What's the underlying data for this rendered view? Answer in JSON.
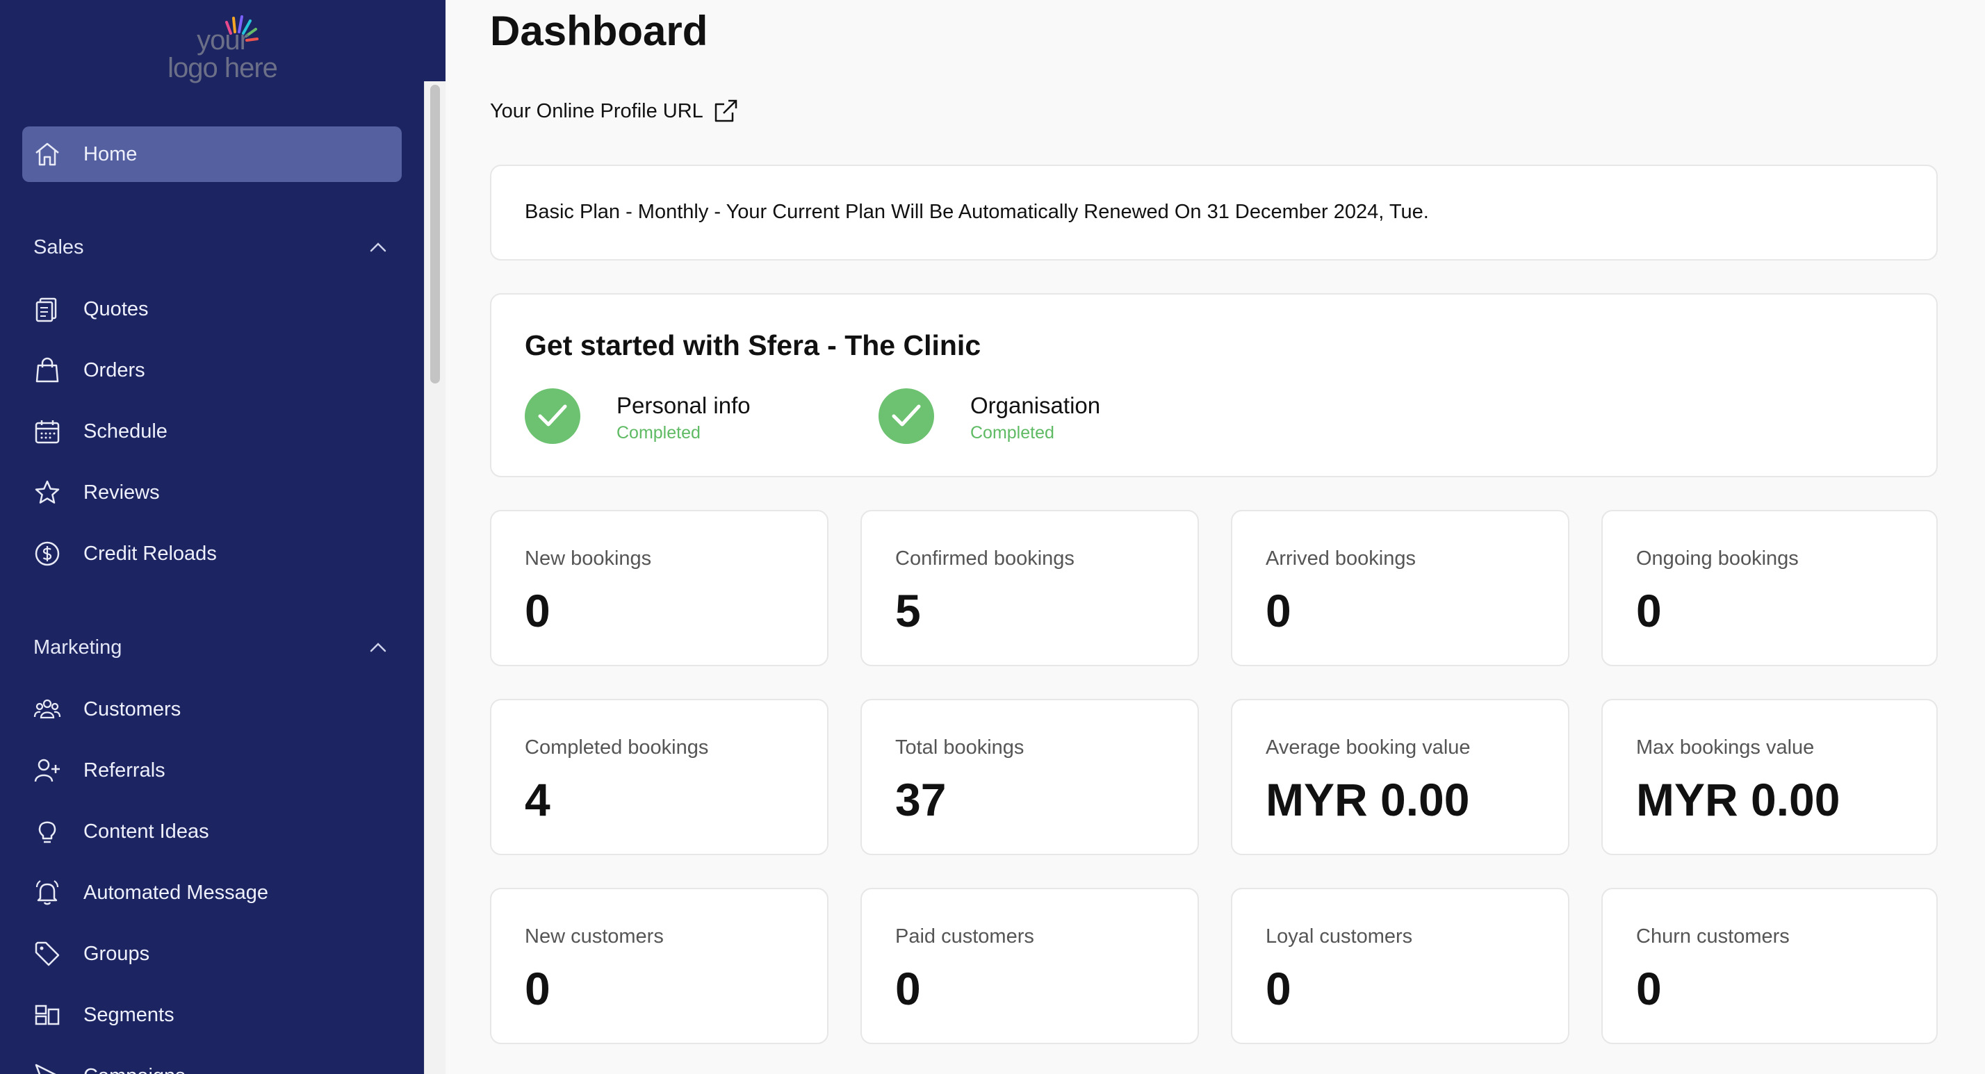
{
  "logo": {
    "line1": "your",
    "line2": "logo here"
  },
  "sidebar": {
    "home": {
      "label": "Home"
    },
    "sections": [
      {
        "title": "Sales",
        "items": [
          "Quotes",
          "Orders",
          "Schedule",
          "Reviews",
          "Credit Reloads"
        ]
      },
      {
        "title": "Marketing",
        "items": [
          "Customers",
          "Referrals",
          "Content Ideas",
          "Automated Message",
          "Groups",
          "Segments",
          "Campaigns"
        ]
      }
    ]
  },
  "main": {
    "title": "Dashboard",
    "profile_link": "Your Online Profile URL",
    "plan_notice": "Basic Plan - Monthly - Your Current Plan Will Be Automatically Renewed On 31 December 2024, Tue.",
    "get_started": {
      "title": "Get started with Sfera - The Clinic",
      "steps": [
        {
          "title": "Personal info",
          "status": "Completed"
        },
        {
          "title": "Organisation",
          "status": "Completed"
        }
      ]
    },
    "stats": [
      {
        "label": "New bookings",
        "value": "0"
      },
      {
        "label": "Confirmed bookings",
        "value": "5"
      },
      {
        "label": "Arrived bookings",
        "value": "0"
      },
      {
        "label": "Ongoing bookings",
        "value": "0"
      },
      {
        "label": "Completed bookings",
        "value": "4"
      },
      {
        "label": "Total bookings",
        "value": "37"
      },
      {
        "label": "Average booking value",
        "value": "MYR 0.00"
      },
      {
        "label": "Max bookings value",
        "value": "MYR 0.00"
      },
      {
        "label": "New customers",
        "value": "0"
      },
      {
        "label": "Paid customers",
        "value": "0"
      },
      {
        "label": "Loyal customers",
        "value": "0"
      },
      {
        "label": "Churn customers",
        "value": "0"
      }
    ]
  },
  "colors": {
    "sidebar_bg": "#1c2461",
    "active_item_bg": "#5560a0",
    "success": "#6cc270"
  }
}
